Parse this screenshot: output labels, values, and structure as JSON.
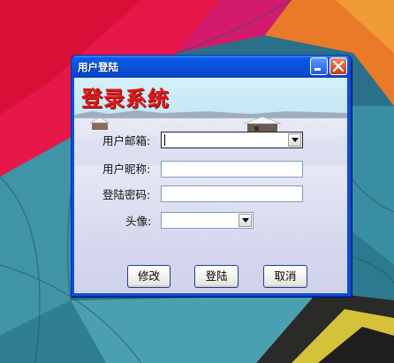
{
  "window": {
    "title": "用户登陆",
    "minimize_label": "minimize",
    "close_label": "close"
  },
  "banner": {
    "heading": "登录系统"
  },
  "form": {
    "email_label": "用户邮箱:",
    "email_value": "",
    "nickname_label": "用户昵称:",
    "nickname_value": "",
    "password_label": "登陆密码:",
    "password_value": "",
    "avatar_label": "头像:",
    "avatar_value": ""
  },
  "buttons": {
    "modify": "修改",
    "login": "登陆",
    "cancel": "取消"
  },
  "colors": {
    "title_bar": "#0a5ae8",
    "heading_red": "#e0191b",
    "client_bg": "#d4d8ee"
  },
  "icons": {
    "minimize": "minimize-icon",
    "close": "close-icon",
    "dropdown": "chevron-down-icon"
  }
}
